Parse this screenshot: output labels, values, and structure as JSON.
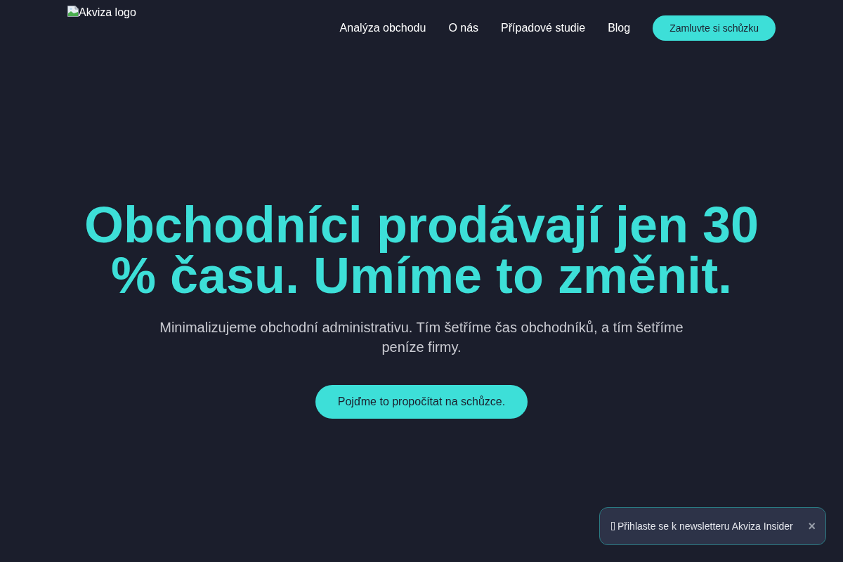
{
  "header": {
    "logo": {
      "alt_text": "Akviza logo"
    },
    "nav_links": [
      "Analýza obchodu",
      "O nás",
      "Případové studie",
      "Blog"
    ],
    "cta_button": "Zamluvte si schůzku"
  },
  "hero": {
    "headline": "Obchodníci prodávají jen 30 % času. Umíme to změnit.",
    "subtitle": "Minimalizujeme obchodní administrativu. Tím šetříme čas obchodníků, a tím šetříme peníze firmy.",
    "cta_button": "Pojďme to propočítat na schůzce."
  },
  "newsletter_toast": {
    "text": "Přihlaste se k newsletteru Akviza Insider",
    "close_label": "×"
  }
}
